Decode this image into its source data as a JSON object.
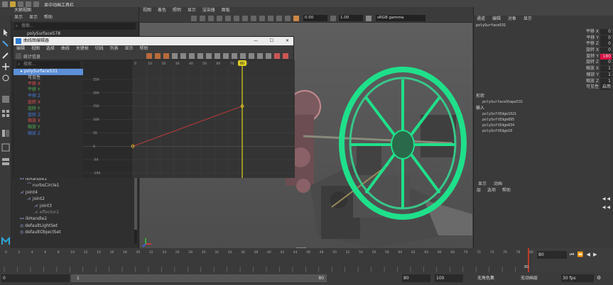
{
  "app": {
    "title_snippet": "显中动画工具栏",
    "accent": "#5c8fd6"
  },
  "outliner": {
    "title": "大纲视图",
    "menus": [
      "显示",
      "显示",
      "帮助"
    ],
    "search_placeholder": "搜索...",
    "top_item": "polySurface578",
    "items": [
      {
        "label": "ikHandle1",
        "indent": 1
      },
      {
        "label": "nurbsCircle1",
        "indent": 2
      },
      {
        "label": "joint4",
        "indent": 1
      },
      {
        "label": "joint2",
        "indent": 2
      },
      {
        "label": "joint3",
        "indent": 3
      },
      {
        "label": "effector2",
        "indent": 3
      },
      {
        "label": "ikHandle2",
        "indent": 1
      },
      {
        "label": "defaultLightSet",
        "indent": 1
      },
      {
        "label": "defaultObjectSet",
        "indent": 1
      }
    ]
  },
  "viewport": {
    "menus": [
      "视图",
      "着色",
      "照明",
      "显示",
      "渲染器",
      "面板"
    ],
    "field_a": "0.00",
    "field_b": "1.00",
    "color_space": "sRGB gamma",
    "camera": "persp"
  },
  "graph_editor": {
    "title": "曲线图编辑器",
    "menus": [
      "编辑",
      "视图",
      "选择",
      "曲线",
      "关键帧",
      "切线",
      "列表",
      "显示",
      "帮助"
    ],
    "stats_label": "统计信息",
    "search_placeholder": "搜索...",
    "node": "polySurface531",
    "channels": [
      "可见性",
      "平移 X",
      "平移 Y",
      "平移 Z",
      "旋转 X",
      "旋转 Y",
      "旋转 Z",
      "缩放 X",
      "缩放 Y",
      "缩放 Z"
    ],
    "x_ticks": [
      "0",
      "10",
      "20",
      "30",
      "40",
      "50",
      "60",
      "70",
      "80"
    ],
    "y_ticks": [
      "250",
      "200",
      "150",
      "100",
      "50",
      "0",
      "-50",
      "-100"
    ],
    "current_frame": "80",
    "key_start": {
      "frame": 0,
      "value": 0
    },
    "key_end": {
      "frame": 80,
      "value": 150
    }
  },
  "channel_box": {
    "menus": [
      "通道",
      "编辑",
      "对象",
      "显示"
    ],
    "node": "polySurface531",
    "attrs": [
      {
        "label": "平移 X",
        "value": "0"
      },
      {
        "label": "平移 Y",
        "value": "0"
      },
      {
        "label": "平移 Z",
        "value": "0"
      },
      {
        "label": "旋转 X",
        "value": "0"
      },
      {
        "label": "旋转 Y",
        "value": "180"
      },
      {
        "label": "旋转 Z",
        "value": "0"
      },
      {
        "label": "缩放 X",
        "value": "1"
      },
      {
        "label": "缩放 Y",
        "value": "1"
      },
      {
        "label": "缩放 Z",
        "value": "1"
      },
      {
        "label": "可见性",
        "value": "启用"
      }
    ],
    "shapes_title": "形状",
    "shape": "polySurfaceShape531",
    "inputs_title": "输入",
    "inputs": [
      "polySoftEdge1021",
      "polySoftEdge895",
      "polySoftEdge834",
      "polySoftEdge10"
    ]
  },
  "layer_editor": {
    "tabs": [
      "显示",
      "动画"
    ],
    "menus": [
      "层",
      "选项",
      "帮助"
    ]
  },
  "timeline": {
    "ticks": [
      "0",
      "2",
      "4",
      "6",
      "8",
      "10",
      "12",
      "14",
      "16",
      "18",
      "20",
      "22",
      "24",
      "26",
      "28",
      "30",
      "32",
      "34",
      "36",
      "38",
      "40",
      "42",
      "44",
      "46",
      "48",
      "50",
      "52",
      "54",
      "56",
      "58",
      "60",
      "62",
      "64",
      "66",
      "68",
      "70",
      "72",
      "74",
      "76",
      "78",
      "80"
    ],
    "current_frame_field": "80",
    "end_label": "80",
    "range_start": "0",
    "playback_start": "1",
    "range_inner_end": "80",
    "range_end": "80",
    "animation_end": "100",
    "char_set": "无角色集",
    "anim_layer": "无动画层",
    "fps": "30 fps"
  }
}
